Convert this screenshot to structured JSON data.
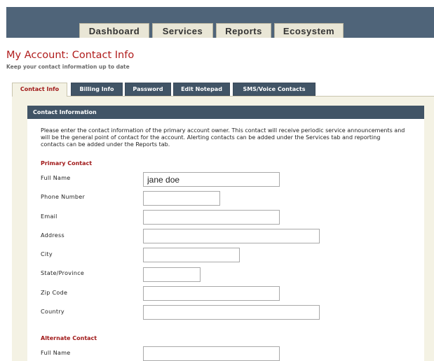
{
  "nav": {
    "tabs": [
      {
        "label": "Dashboard"
      },
      {
        "label": "Services"
      },
      {
        "label": "Reports"
      },
      {
        "label": "Ecosystem"
      }
    ]
  },
  "page": {
    "title": "My Account: Contact Info",
    "subtitle": "Keep your contact information up to date"
  },
  "subtabs": [
    {
      "label": "Contact Info",
      "active": true
    },
    {
      "label": "Billing Info",
      "active": false
    },
    {
      "label": "Password",
      "active": false
    },
    {
      "label": "Edit Notepad",
      "active": false
    },
    {
      "label": "SMS/Voice Contacts",
      "active": false
    }
  ],
  "section": {
    "header": "Contact Information",
    "intro": "Please enter the contact information of the primary account owner. This contact will receive periodic service announcements and will be the general point of contact for the account. Alerting contacts can be added under the Services tab and reporting contacts can be added under the Reports tab."
  },
  "primary": {
    "label": "Primary Contact",
    "fields": [
      {
        "label": "Full Name",
        "value": "jane doe"
      },
      {
        "label": "Phone Number",
        "value": ""
      },
      {
        "label": "Email",
        "value": ""
      },
      {
        "label": "Address",
        "value": ""
      },
      {
        "label": "City",
        "value": ""
      },
      {
        "label": "State/Province",
        "value": ""
      },
      {
        "label": "Zip Code",
        "value": ""
      },
      {
        "label": "Country",
        "value": ""
      }
    ]
  },
  "alternate": {
    "label": "Alternate Contact",
    "fields": [
      {
        "label": "Full Name",
        "value": ""
      }
    ]
  },
  "colors": {
    "nav_bar": "#4f6479",
    "title_red": "#b01c1c",
    "tab_dark": "#415466",
    "panel_cream": "#f4f2e4"
  }
}
